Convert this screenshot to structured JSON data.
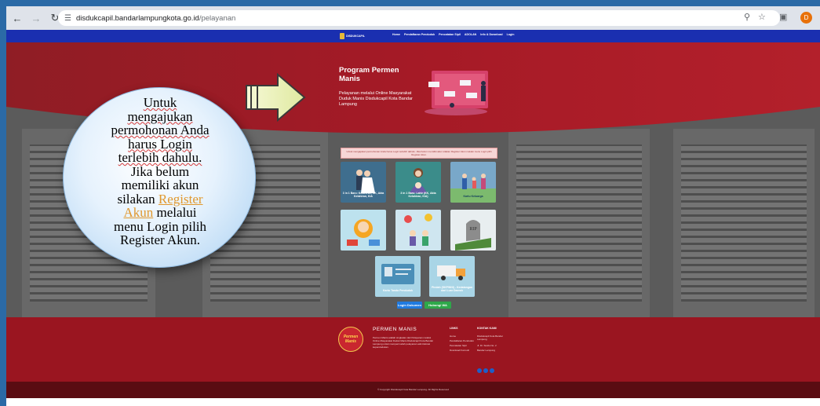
{
  "browser": {
    "url_domain": "disdukcapil.bandarlampungkota.go.id",
    "url_path": "/pelayanan",
    "profile_initial": "D"
  },
  "site": {
    "logo_text": "DISDUKCAPIL",
    "nav_items": [
      "Home",
      "Pendaftaran Penduduk",
      "Pencatatan Sipil",
      "ADOLAN",
      "Info & Download",
      "Login"
    ]
  },
  "hero": {
    "title": "Program Permen Manis",
    "subtitle": "Pelayanan melalui Online Masyarakat Duduk Manis Disdukcapil Kota Bandar Lampung"
  },
  "notice": "Untuk mengajukan permohonan Anda harus Login terlebih dahulu. Jika belum memiliki akun silakan Register Akun melalui menu Login pilih Register Akun.",
  "services": [
    {
      "label": "3 in 1 Baru: Kelahiran, KK, Akta Kelahiran, KIA",
      "color": "#3f6e8e"
    },
    {
      "label": "3 in 1 Baru: Lahir (KK, Akta Kelahiran, KIA)",
      "color": "#3b8c8a"
    },
    {
      "label": "Kartu Keluarga",
      "color": "#79a8c9"
    },
    {
      "label": "",
      "color": "#7fb8c9"
    },
    {
      "label": "",
      "color": "#9ac5d9"
    },
    {
      "label": "",
      "color": "#7aa6b8"
    },
    {
      "label": "Kartu Tanda Penduduk",
      "color": "#5aa0c6"
    },
    {
      "label": "Pindah (SKPWNI) - Kedatangan dari Luar Daerah",
      "color": "#6bb0d0"
    }
  ],
  "buttons": {
    "login": "Login Dokumen",
    "whatsapp": "Hubungi WA"
  },
  "footer": {
    "logo_text": "Permen Manis",
    "title": "PERMEN MANIS",
    "description": "Permen Manis adalah singkatan dari Pelayanan melalui Online Masyarakat Duduk Manis Disdukcapil Kota Bandar Lampung untuk mempermudah pelayanan administrasi kependudukan.",
    "links_heading": "LINKS",
    "links": [
      "Home",
      "Pendaftaran Penduduk",
      "Pencatatan Sipil",
      "Download Formulir"
    ],
    "contact_heading": "KONTAK KAMI",
    "contact": [
      "Disdukcapil Kota Bandar Lampung",
      "Jl. Dr. Susilo No. 2",
      "Bandar Lampung"
    ],
    "copyright": "© Copyright Disdukcapil Kota Bandar Lampung. All Rights Reserved"
  },
  "annotation": {
    "line1": "Untuk",
    "line2": "mengajukan",
    "line3": "permohonan Anda",
    "line4": "harus Login",
    "line5": "terlebih dahulu.",
    "line6": "Jika belum",
    "line7": "memiliki akun",
    "line8a": "silakan ",
    "line8b": "Register",
    "line9a": "Akun",
    "line9b": " melalui",
    "line10": "menu Login pilih",
    "line11": "Register Akun."
  }
}
